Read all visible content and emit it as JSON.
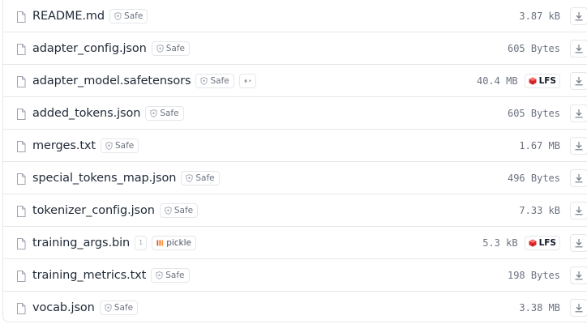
{
  "files": [
    {
      "name": "README.md",
      "badge": "Safe",
      "size": "3.87 kB",
      "lfs": false
    },
    {
      "name": "adapter_config.json",
      "badge": "Safe",
      "size": "605 Bytes",
      "lfs": false
    },
    {
      "name": "adapter_model.safetensors",
      "badge": "Safe",
      "size": "40.4 MB",
      "lfs": true,
      "lfs_label": "LFS",
      "extra_badge": "link"
    },
    {
      "name": "added_tokens.json",
      "badge": "Safe",
      "size": "605 Bytes",
      "lfs": false
    },
    {
      "name": "merges.txt",
      "badge": "Safe",
      "size": "1.67 MB",
      "lfs": false
    },
    {
      "name": "special_tokens_map.json",
      "badge": "Safe",
      "size": "496 Bytes",
      "lfs": false
    },
    {
      "name": "tokenizer_config.json",
      "badge": "Safe",
      "size": "7.33 kB",
      "lfs": false
    },
    {
      "name": "training_args.bin",
      "badge": "pickle",
      "size": "5.3 kB",
      "lfs": true,
      "lfs_label": "LFS",
      "info_badge": "1"
    },
    {
      "name": "training_metrics.txt",
      "badge": "Safe",
      "size": "198 Bytes",
      "lfs": false
    },
    {
      "name": "vocab.json",
      "badge": "Safe",
      "size": "3.38 MB",
      "lfs": false
    }
  ],
  "icons": {
    "file": "file-icon",
    "safe": "shield-icon",
    "download": "download-icon",
    "lfs": "lfs-cube-icon",
    "pickle": "pickle-icon",
    "info": "info-icon"
  },
  "colors": {
    "border": "#e5e7eb",
    "muted": "#6b7280",
    "lfs_red": "#dc2626",
    "pickle_orange": "#ea580c"
  }
}
